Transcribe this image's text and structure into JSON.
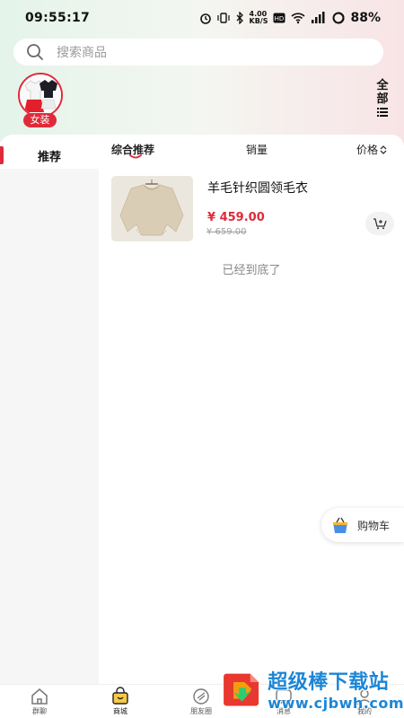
{
  "status_bar": {
    "time": "09:55:17",
    "network_speed": "4.00\nKB/S",
    "battery": "88%"
  },
  "search": {
    "placeholder": "搜索商品"
  },
  "categories": [
    {
      "label": "女装",
      "selected": true
    }
  ],
  "all_toggle": {
    "label_line1": "全",
    "label_line2": "部"
  },
  "sidebar": {
    "items": [
      {
        "label": "推荐",
        "active": true
      }
    ]
  },
  "sort_bar": {
    "comprehensive": "综合推荐",
    "sales": "销量",
    "price": "价格"
  },
  "products": [
    {
      "title": "羊毛针织圆领毛衣",
      "price": "¥ 459.00",
      "original_price": "¥ 659.00"
    }
  ],
  "end_of_list": "已经到底了",
  "floating_cart": {
    "label": "购物车"
  },
  "bottom_nav": [
    {
      "label": "群聊",
      "icon": "home-icon"
    },
    {
      "label": "商城",
      "icon": "shopping-bag-icon",
      "active": true
    },
    {
      "label": "朋友圈",
      "icon": "moments-icon"
    },
    {
      "label": "消息",
      "icon": "message-icon"
    },
    {
      "label": "我的",
      "icon": "profile-icon"
    }
  ],
  "watermark": {
    "title": "超级棒下载站",
    "url": "www.cjbwh.com"
  },
  "colors": {
    "accent": "#e02a3a",
    "watermark_blue": "#1c86d6"
  }
}
